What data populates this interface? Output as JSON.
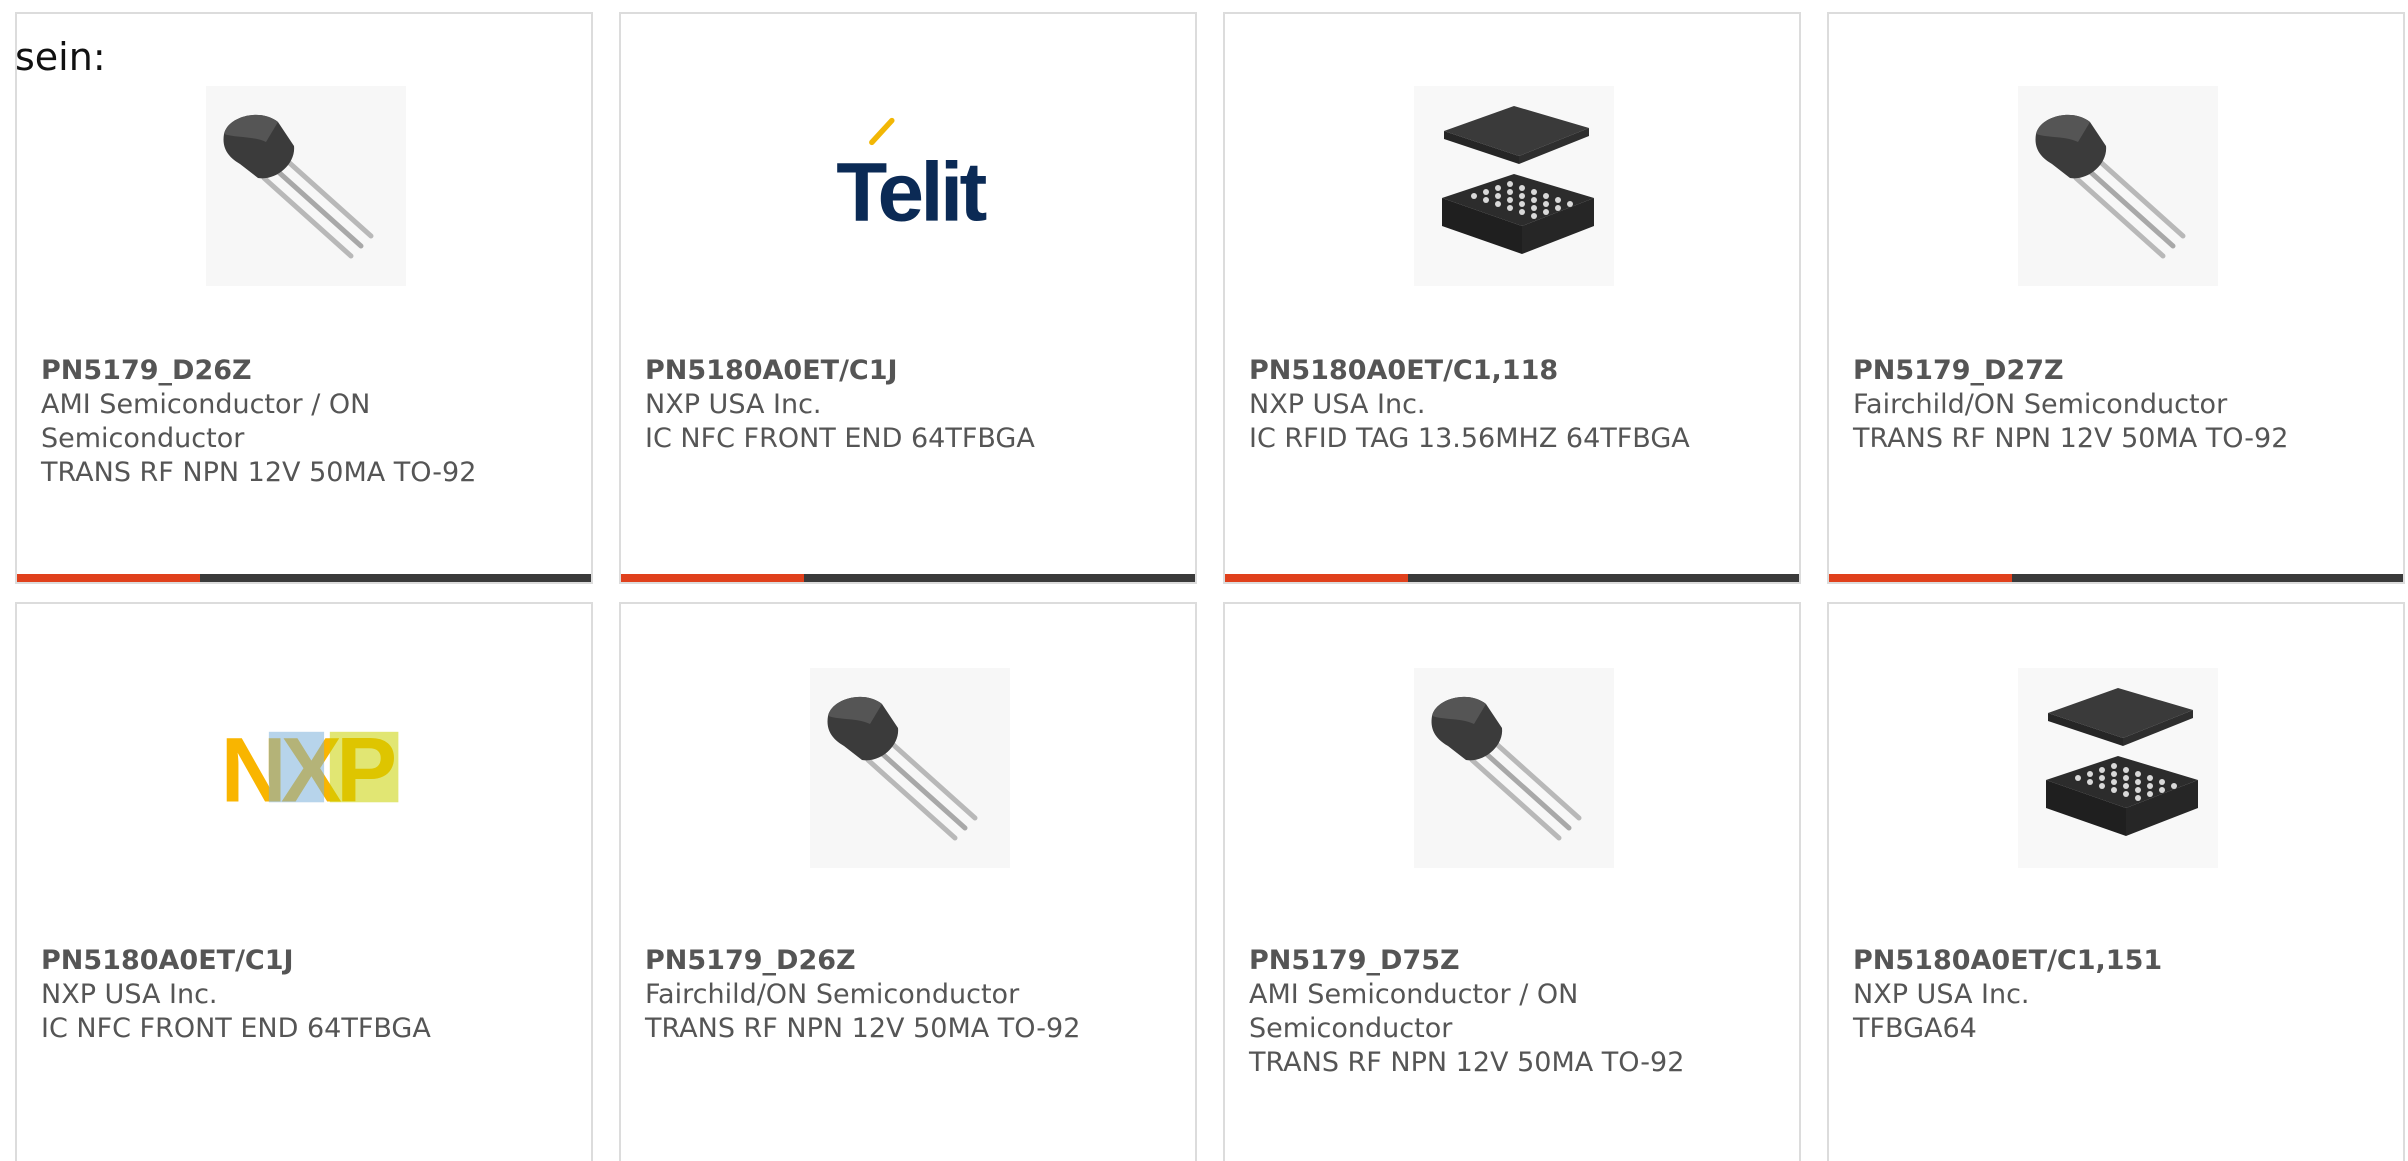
{
  "intro_text": "sein:",
  "colors": {
    "accent": "#e0401c",
    "bar": "#3a3a3a",
    "card_border": "#dcdcdc",
    "text": "#555555"
  },
  "products": [
    {
      "part_number": "PN5179_D26Z",
      "manufacturer": "AMI Semiconductor / ON Semiconductor",
      "description": "TRANS RF NPN 12V 50MA TO-92",
      "image": "to92-transistor"
    },
    {
      "part_number": "PN5180A0ET/C1J",
      "manufacturer": "NXP USA Inc.",
      "description": "IC NFC FRONT END 64TFBGA",
      "image": "telit-logo",
      "logo_text": "Telit"
    },
    {
      "part_number": "PN5180A0ET/C1,118",
      "manufacturer": "NXP USA Inc.",
      "description": "IC RFID TAG 13.56MHZ 64TFBGA",
      "image": "bga-chip"
    },
    {
      "part_number": "PN5179_D27Z",
      "manufacturer": "Fairchild/ON Semiconductor",
      "description": "TRANS RF NPN 12V 50MA TO-92",
      "image": "to92-transistor"
    },
    {
      "part_number": "PN5180A0ET/C1J",
      "manufacturer": "NXP USA Inc.",
      "description": "IC NFC FRONT END 64TFBGA",
      "image": "nxp-logo",
      "logo_text": "NXP"
    },
    {
      "part_number": "PN5179_D26Z",
      "manufacturer": "Fairchild/ON Semiconductor",
      "description": "TRANS RF NPN 12V 50MA TO-92",
      "image": "to92-transistor"
    },
    {
      "part_number": "PN5179_D75Z",
      "manufacturer": "AMI Semiconductor / ON Semiconductor",
      "description": "TRANS RF NPN 12V 50MA TO-92",
      "image": "to92-transistor"
    },
    {
      "part_number": "PN5180A0ET/C1,151",
      "manufacturer": "NXP USA Inc.",
      "description": "TFBGA64",
      "image": "bga-chip"
    }
  ]
}
